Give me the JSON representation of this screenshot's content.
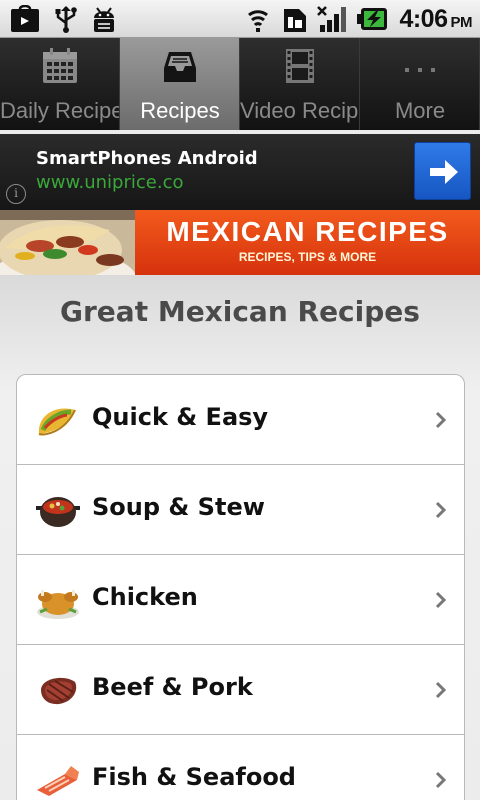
{
  "status_bar": {
    "time": "4:06",
    "ampm": "PM",
    "left_icons": [
      "bag-download-icon",
      "usb-icon",
      "android-debug-icon"
    ],
    "right_icons": [
      "wifi-icon",
      "sim-icon",
      "signal-icon",
      "battery-charging-icon"
    ]
  },
  "tabs": [
    {
      "label": "Daily Recipes",
      "icon": "calendar-icon",
      "active": false
    },
    {
      "label": "Recipes",
      "icon": "inbox-tray-icon",
      "active": true
    },
    {
      "label": "Video Recipe",
      "icon": "film-icon",
      "active": false
    },
    {
      "label": "More",
      "icon": "more-dots-icon",
      "active": false
    }
  ],
  "ad": {
    "title": "SmartPhones Android",
    "url": "www.uniprice.co",
    "info_glyph": "i",
    "colors": {
      "url": "#3aa83a",
      "button": "#2067d6"
    }
  },
  "banner": {
    "title": "MEXICAN RECIPES",
    "subtitle": "RECIPES, TIPS & MORE",
    "colors": {
      "background": "#e8461a"
    }
  },
  "main": {
    "title": "Great Mexican Recipes",
    "categories": [
      {
        "label": "Quick & Easy",
        "icon": "taco-icon"
      },
      {
        "label": "Soup & Stew",
        "icon": "stew-pot-icon"
      },
      {
        "label": "Chicken",
        "icon": "roast-chicken-icon"
      },
      {
        "label": "Beef & Pork",
        "icon": "steak-icon"
      },
      {
        "label": "Fish & Seafood",
        "icon": "salmon-icon"
      }
    ]
  }
}
